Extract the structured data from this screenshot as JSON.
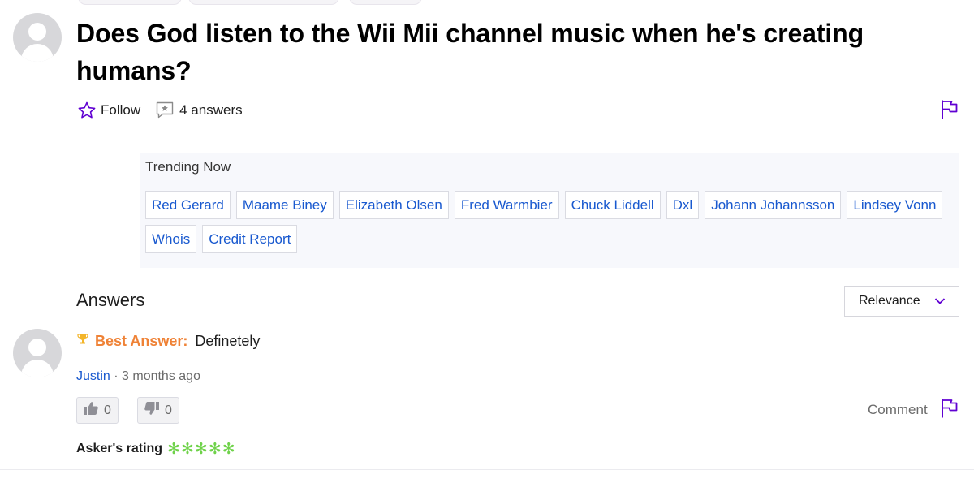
{
  "question": {
    "title": "Does God listen to the Wii Mii channel music when he's creating humans?",
    "follow_label": "Follow",
    "answers_count": "4 answers"
  },
  "trending": {
    "title": "Trending Now",
    "items": [
      "Red Gerard",
      "Maame Biney",
      "Elizabeth Olsen",
      "Fred Warmbier",
      "Chuck Liddell",
      "Dxl",
      "Johann Johannsson",
      "Lindsey Vonn",
      "Whois",
      "Credit Report"
    ]
  },
  "answers_section": {
    "heading": "Answers",
    "sort_value": "Relevance"
  },
  "best_answer": {
    "label": "Best Answer:",
    "text": "Definetely",
    "user": "Justin",
    "separator": " · ",
    "time": "3 months ago",
    "upvotes": "0",
    "downvotes": "0",
    "comment_label": "Comment",
    "rating_label": "Asker's rating",
    "rating_stars": 5
  },
  "colors": {
    "accent": "#6001d2",
    "link": "#1959cf",
    "best_answer": "#ef8236",
    "stars": "#6fd24a"
  },
  "icons": {
    "follow": "star-outline-icon",
    "answers": "speech-bubble-star-icon",
    "flag": "flag-icon",
    "sort": "chevron-down-icon",
    "best": "trophy-icon",
    "upvote": "thumbs-up-icon",
    "downvote": "thumbs-down-icon"
  }
}
